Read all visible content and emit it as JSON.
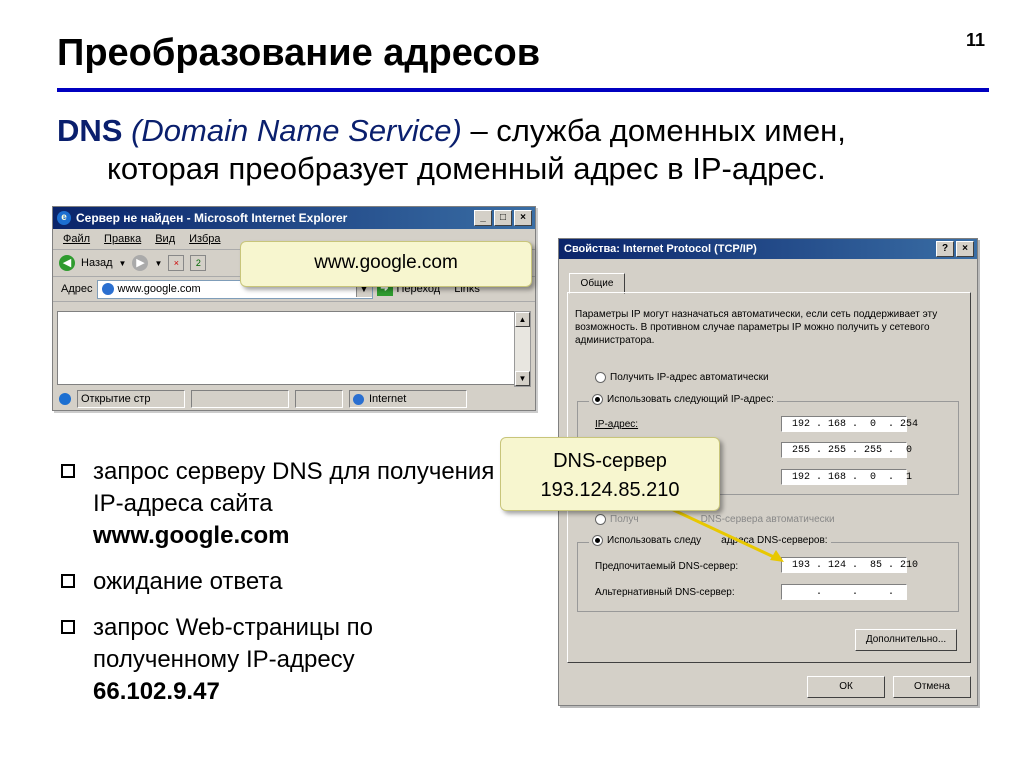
{
  "slide": {
    "title": "Преобразование адресов",
    "number": "11",
    "def_dns": "DNS",
    "def_full": "(Domain Name Service)",
    "def_rest": " – служба доменных имен,",
    "def_line2": "которая преобразует доменный адрес в IP-адрес."
  },
  "ie": {
    "title": "Сервер не найден - Microsoft Internet Explorer",
    "menu": [
      "Файл",
      "Правка",
      "Вид",
      "Избра"
    ],
    "back_label": "Назад",
    "address_label": "Адрес",
    "address_value": "www.google.com",
    "go_label": "Переход",
    "links_label": "Links",
    "status_text": "Открытие стр",
    "zone_text": "Internet"
  },
  "callouts": {
    "url": "www.google.com",
    "dns_line1": "DNS-сервер",
    "dns_line2": "193.124.85.210"
  },
  "bullets": [
    {
      "text": "запрос серверу DNS для получения IP-адреса сайта",
      "bold": "www.google.com"
    },
    {
      "text": "ожидание ответа",
      "bold": ""
    },
    {
      "text": "запрос Web-страницы по полученному IP-адресу",
      "bold": "66.102.9.47"
    }
  ],
  "dialog": {
    "title": "Свойства: Internet Protocol (TCP/IP)",
    "tab": "Общие",
    "para": "Параметры IP могут назначаться автоматически, если сеть поддерживает эту возможность. В противном случае параметры IP можно получить у сетевого администратора.",
    "radio_auto_ip": "Получить IP-адрес автоматически",
    "radio_manual_ip": "Использовать следующий IP-адрес:",
    "ip_label": "IP-адрес:",
    "ip_value": " 192 . 168 .  0  . 254",
    "mask_value": " 255 . 255 . 255 .  0",
    "gw_value": " 192 . 168 .  0  .  1",
    "radio_auto_dns_a": "Получ",
    "radio_auto_dns_b": "DNS-сервера автоматически",
    "radio_manual_dns_a": "Использовать следу",
    "radio_manual_dns_b": "адреса DNS-серверов:",
    "pref_dns_label": "Предпочитаемый DNS-сервер:",
    "pref_dns_value": " 193 . 124 .  85 . 210",
    "alt_dns_label": "Альтернативный DNS-сервер:",
    "alt_dns_value": "     .     .     .",
    "advanced_label": "Дополнительно...",
    "ok_label": "ОК",
    "cancel_label": "Отмена"
  }
}
